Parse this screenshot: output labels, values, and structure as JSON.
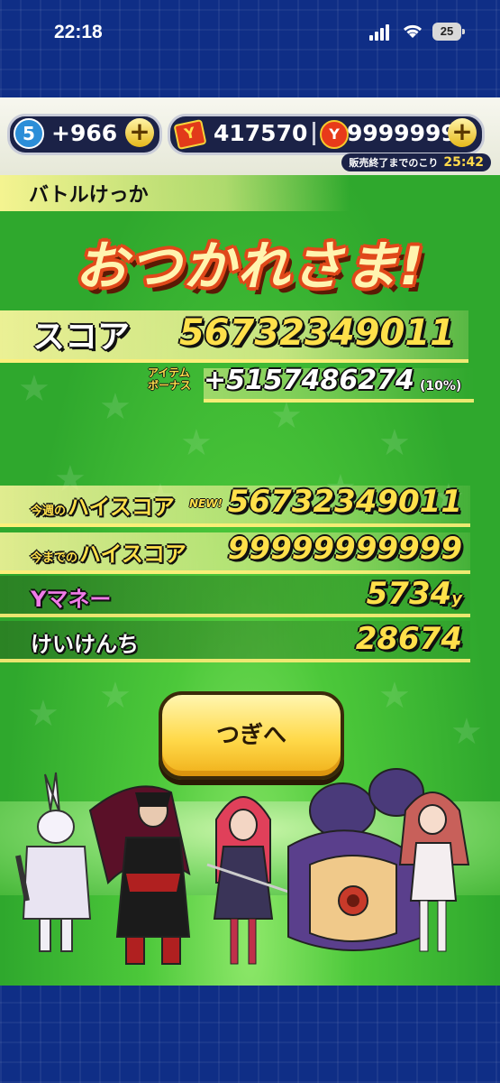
{
  "status_bar": {
    "time": "22:18",
    "battery": "25"
  },
  "currency": {
    "crystal_level": "5",
    "crystal_amount": "+966",
    "tickets": "417570",
    "coins": "9999999",
    "plus_label": "+",
    "coin_glyph": "Y",
    "ticket_glyph": "Y",
    "sale_label": "販売終了までのこり",
    "sale_timer": "25:42"
  },
  "result": {
    "header": "バトルけっか",
    "title": "おつかれさま!",
    "score_label": "スコア",
    "score_value": "56732349011",
    "bonus_label_line1": "アイテム",
    "bonus_label_line2": "ボーナス",
    "bonus_value": "+5157486274",
    "bonus_percent": "(10%)",
    "rows": [
      {
        "label_small": "今週の",
        "label": "ハイスコア",
        "value": "56732349011",
        "badge": "NEW!"
      },
      {
        "label_small": "今までの",
        "label": "ハイスコア",
        "value": "99999999999"
      },
      {
        "label": "Yマネー",
        "value": "5734",
        "unit": "y"
      },
      {
        "label": "けいけんち",
        "value": "28674"
      }
    ],
    "next_button": "つぎへ"
  },
  "colors": {
    "frame": "#0f2e86",
    "game_green": "#2fa82d",
    "score_yellow": "#ffe04a",
    "title_red": "#e0481a",
    "button_yellow": "#ffd94a"
  }
}
